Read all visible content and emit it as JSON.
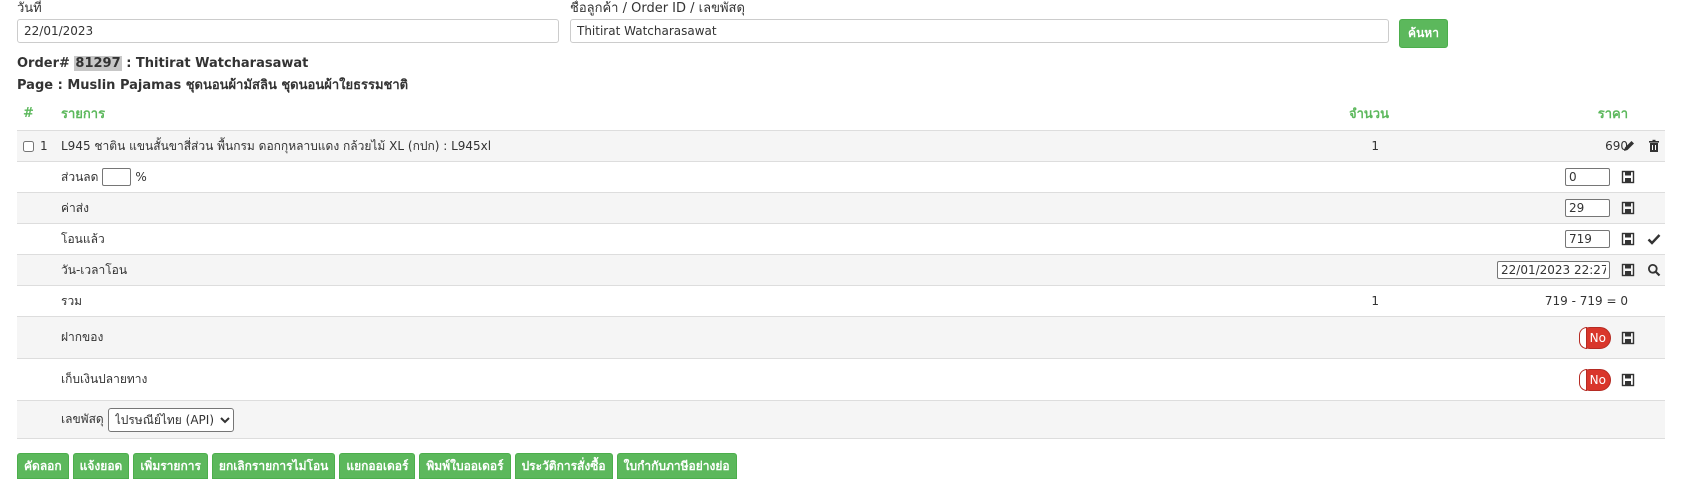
{
  "search": {
    "date_label": "วันที่",
    "date_value": "22/01/2023",
    "customer_label": "ชื่อลูกค้า / Order ID / เลขพัสดุ",
    "customer_value": "Thitirat Watcharasawat",
    "search_button": "ค้นหา"
  },
  "order": {
    "prefix": "Order#",
    "id": "81297",
    "customer": ": Thitirat Watcharasawat",
    "page_line": "Page : Muslin Pajamas ชุดนอนผ้ามัสลิน ชุดนอนผ้าใยธรรมชาติ"
  },
  "table": {
    "headers": {
      "index": "#",
      "item": "รายการ",
      "qty": "จำนวน",
      "price": "ราคา"
    },
    "item": {
      "index": "1",
      "name": "L945 ชาติน แขนสั้นขาสี่ส่วน พื้นกรม ดอกกุหลาบแดง กล้วยไม้ XL (กปก) : L945xl",
      "qty": "1",
      "price": "690"
    },
    "discount": {
      "label": "ส่วนลด",
      "percent_sign": "%",
      "percent_value": "",
      "value": "0"
    },
    "shipping": {
      "label": "ค่าส่ง",
      "value": "29"
    },
    "transferred": {
      "label": "โอนแล้ว",
      "value": "719"
    },
    "transfer_time": {
      "label": "วัน-เวลาโอน",
      "value": "22/01/2023 22:27"
    },
    "total": {
      "label": "รวม",
      "qty": "1",
      "summary": "719 - 719 = 0"
    },
    "deposit": {
      "label": "ฝากของ",
      "toggle": "No"
    },
    "cod": {
      "label": "เก็บเงินปลายทาง",
      "toggle": "No"
    },
    "tracking": {
      "label": "เลขพัสดุ",
      "selected": "ไปรษณีย์ไทย (API)"
    }
  },
  "actions": [
    "คัดลอก",
    "แจ้งยอด",
    "เพิ่มรายการ",
    "ยกเลิกรายการไม่โอน",
    "แยกออเดอร์",
    "พิมพ์ใบออเดอร์",
    "ประวัติการสั่งซื้อ",
    "ใบกำกับภาษีอย่างย่อ"
  ],
  "colors": {
    "accent": "#5cb85c",
    "toggle_off": "#d9362b",
    "alt_row": "#f5f5f5"
  },
  "icons": [
    "pencil-icon",
    "trash-icon",
    "save-icon",
    "check-icon",
    "search-icon"
  ]
}
